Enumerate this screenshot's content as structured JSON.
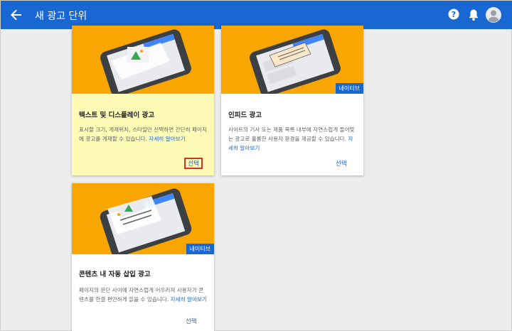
{
  "header": {
    "title": "새 광고 단위",
    "back_icon": "arrow-back-icon",
    "help_icon": "help-icon",
    "bell_icon": "notifications-icon",
    "avatar_icon": "account-icon"
  },
  "colors": {
    "primary": "#1967d2",
    "art": "#f9a602",
    "highlight": "#fdfbb6",
    "select_box": "#d93025"
  },
  "cards": [
    {
      "title": "텍스트 및 디스플레이 광고",
      "desc": "표시할 크기, 게재위치, 스타일만 선택하면 간단히 페이지에 광고를 게재할 수 있습니다.",
      "link": "자세히 알아보기",
      "select": "선택",
      "badge": ""
    },
    {
      "title": "인피드 광고",
      "desc": "사이트의 기사 또는 제품 목록 내부에 자연스럽게 들어맞는 광고로 훌륭한 사용자 환경을 제공할 수 있습니다.",
      "link": "자세히 알아보기",
      "select": "선택",
      "badge": "네이티브"
    },
    {
      "title": "콘텐츠 내 자동 삽입 광고",
      "desc": "페이지의 문단 사이에 자연스럽게 어우러져 사용자가 콘텐츠를 한결 편안하게 읽을 수 있습니다.",
      "link": "자세히 알아보기",
      "select": "선택",
      "badge": "네이티브"
    }
  ]
}
